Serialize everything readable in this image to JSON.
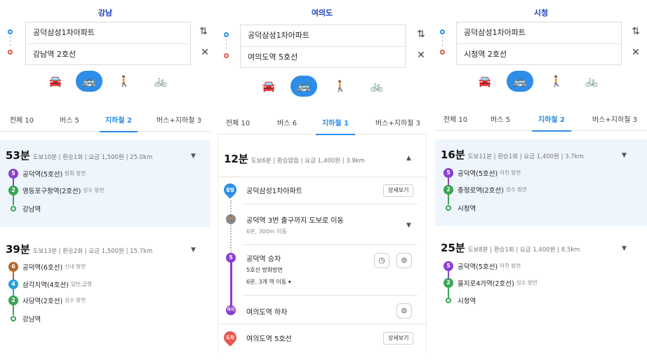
{
  "common": {
    "modes": [
      "🚘",
      "🚌",
      "🚶",
      "🚲"
    ],
    "origin": "공덕삼성1차아파트",
    "swap_icon": "⇅",
    "clear_icon": "✕",
    "caret_down": "▼",
    "caret_up": "▲"
  },
  "panels": [
    {
      "title": "강남",
      "dest": "강남역 2호선",
      "tabs": [
        "전체 10",
        "버스 5",
        "지하철 2",
        "버스+지하철 3"
      ],
      "active_tab": 2,
      "routes": [
        {
          "time": "53분",
          "meta": "도보10분 | 환승1회 | 요금 1,500원 | 25.0km",
          "steps": [
            {
              "badge": "5",
              "color": "#8b3fd0",
              "name": "공덕역(5호선)",
              "dir": "방화 방면"
            },
            {
              "badge": "2",
              "color": "#3aa655",
              "name": "영등포구청역(2호선)",
              "dir": "성수 방면"
            },
            {
              "badge": "",
              "color": "#3aa655",
              "name": "강남역",
              "dir": ""
            }
          ]
        },
        {
          "time": "39분",
          "meta": "도보13분 | 환승2회 | 요금 1,500원 | 15.7km",
          "steps": [
            {
              "badge": "6",
              "color": "#b8662c",
              "name": "공덕역(6호선)",
              "dir": "신내 방면"
            },
            {
              "badge": "4",
              "color": "#2aa0d8",
              "name": "삼각지역(4호선)",
              "dir": "일반,급행"
            },
            {
              "badge": "2",
              "color": "#3aa655",
              "name": "사당역(2호선)",
              "dir": "성수 방면"
            },
            {
              "badge": "",
              "color": "#3aa655",
              "name": "강남역",
              "dir": ""
            }
          ]
        }
      ]
    },
    {
      "title": "여의도",
      "dest": "여의도역 5호선",
      "tabs": [
        "전체 10",
        "버스 6",
        "지하철 1",
        "버스+지하철 3"
      ],
      "active_tab": 2,
      "detail": {
        "time": "12분",
        "meta": "도보6분 | 환승없음 | 요금 1,400원 | 3.9km",
        "start_pin": "출발",
        "start_name": "공덕삼성1차아파트",
        "detail_btn": "상세보기",
        "walk_title": "공덕역 3번 출구까지 도보로 이동",
        "walk_sub": "6분, 300m 이동",
        "board_badge": "5",
        "board_title": "공덕역 승차",
        "board_line": "5호선 방화방면",
        "board_sub": "6분, 3개 역 이동 ▾",
        "clock_icon": "◷",
        "pin_icon": "⊚",
        "alight_pin": "하차",
        "alight_title": "여의도역 하차",
        "end_pin": "도착",
        "end_name": "여의도역 5호선",
        "end_btn": "상세보기"
      }
    },
    {
      "title": "시청",
      "dest": "시청역 2호선",
      "tabs": [
        "전체 10",
        "버스 5",
        "지하철 2",
        "버스+지하철 3"
      ],
      "active_tab": 2,
      "routes": [
        {
          "time": "16분",
          "meta": "도보11분 | 환승1회 | 요금 1,400원 | 3.7km",
          "steps": [
            {
              "badge": "5",
              "color": "#8b3fd0",
              "name": "공덕역(5호선)",
              "dir": "마천 방면"
            },
            {
              "badge": "2",
              "color": "#3aa655",
              "name": "충정로역(2호선)",
              "dir": "성수 방면"
            },
            {
              "badge": "",
              "color": "#3aa655",
              "name": "시청역",
              "dir": ""
            }
          ]
        },
        {
          "time": "25분",
          "meta": "도보8분 | 환승1회 | 요금 1,400원 | 8.5km",
          "steps": [
            {
              "badge": "5",
              "color": "#8b3fd0",
              "name": "공덕역(5호선)",
              "dir": "마천 방면"
            },
            {
              "badge": "2",
              "color": "#3aa655",
              "name": "을지로4가역(2호선)",
              "dir": "성수 방면"
            },
            {
              "badge": "",
              "color": "#3aa655",
              "name": "시청역",
              "dir": ""
            }
          ]
        }
      ]
    }
  ]
}
